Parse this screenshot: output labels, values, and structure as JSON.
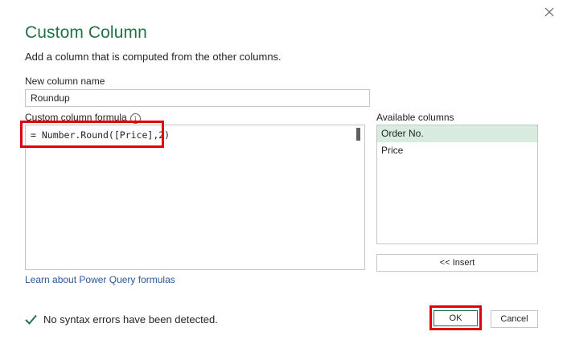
{
  "dialog": {
    "title": "Custom Column",
    "subtitle": "Add a column that is computed from the other columns."
  },
  "name_field": {
    "label": "New column name",
    "value": "Roundup"
  },
  "formula": {
    "label": "Custom column formula",
    "value": "= Number.Round([Price],2)",
    "info_icon": "info-icon"
  },
  "available": {
    "label": "Available columns",
    "items": [
      {
        "label": "Order No.",
        "selected": true
      },
      {
        "label": "Price",
        "selected": false
      }
    ],
    "insert_label": "<< Insert"
  },
  "learn_link": "Learn about Power Query formulas",
  "status": {
    "text": "No syntax errors have been detected.",
    "icon": "checkmark-icon"
  },
  "buttons": {
    "ok": "OK",
    "cancel": "Cancel"
  },
  "colors": {
    "title": "#217346",
    "selection": "#d7ebdf",
    "highlight": "#e0000a",
    "check": "#217346",
    "link": "#2b579a"
  }
}
